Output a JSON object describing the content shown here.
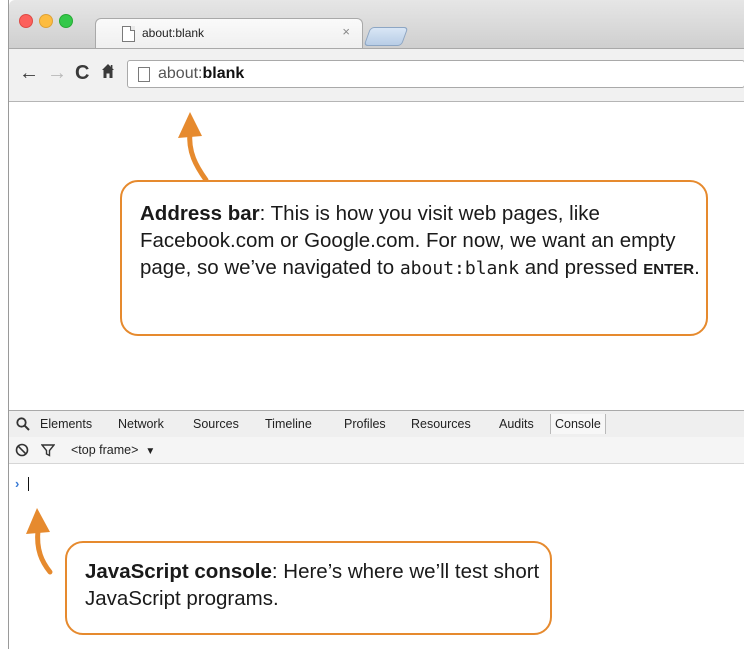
{
  "browser": {
    "tab_title": "about:blank",
    "tab_close": "×",
    "url_prefix": "about:",
    "url_host": "blank"
  },
  "devtools": {
    "tabs": [
      "Elements",
      "Network",
      "Sources",
      "Timeline",
      "Profiles",
      "Resources",
      "Audits",
      "Console"
    ],
    "active_tab": "Console",
    "frame_selector": "<top frame>",
    "frame_caret": "▼",
    "prompt": "›"
  },
  "callouts": {
    "address": {
      "heading": "Address bar",
      "text1": ": This is how you visit web pages, like Facebook.com or Google.com. For now, we want an empty page, so we’ve navigated to ",
      "code": "about:blank",
      "text2": " and pressed ",
      "key": "ENTER",
      "end": "."
    },
    "console": {
      "heading": "JavaScript console",
      "text": ": Here’s where we’ll test short JavaScript programs."
    }
  },
  "colors": {
    "callout_accent": "#e68a2e",
    "prompt_blue": "#3a7bd5"
  }
}
